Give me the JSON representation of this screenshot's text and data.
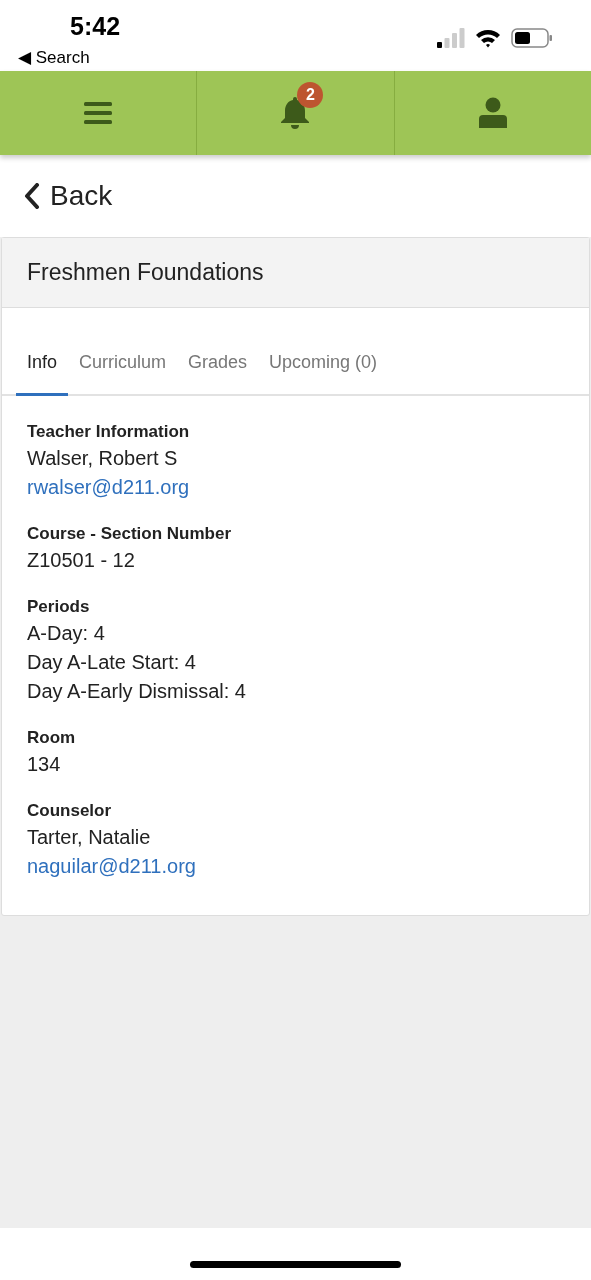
{
  "status_bar": {
    "time": "5:42",
    "back_app": "◀ Search"
  },
  "nav": {
    "notification_count": "2"
  },
  "back": {
    "label": "Back"
  },
  "card": {
    "title": "Freshmen Foundations",
    "tabs": [
      {
        "label": "Info",
        "selected": true
      },
      {
        "label": "Curriculum",
        "selected": false
      },
      {
        "label": "Grades",
        "selected": false
      },
      {
        "label": "Upcoming (0)",
        "selected": false
      }
    ],
    "sections": [
      {
        "label": "Teacher Information",
        "lines": [
          {
            "kind": "text",
            "text": "Walser, Robert S"
          },
          {
            "kind": "link",
            "text": "rwalser@d211.org"
          }
        ]
      },
      {
        "label": "Course - Section Number",
        "lines": [
          {
            "kind": "text",
            "text": "Z10501 - 12"
          }
        ]
      },
      {
        "label": "Periods",
        "lines": [
          {
            "kind": "text",
            "text": "A-Day: 4"
          },
          {
            "kind": "text",
            "text": "Day A-Late Start: 4"
          },
          {
            "kind": "text",
            "text": "Day A-Early Dismissal: 4"
          }
        ]
      },
      {
        "label": "Room",
        "lines": [
          {
            "kind": "text",
            "text": "134"
          }
        ]
      },
      {
        "label": "Counselor",
        "lines": [
          {
            "kind": "text",
            "text": "Tarter, Natalie"
          },
          {
            "kind": "link",
            "text": "naguilar@d211.org"
          }
        ]
      }
    ]
  }
}
